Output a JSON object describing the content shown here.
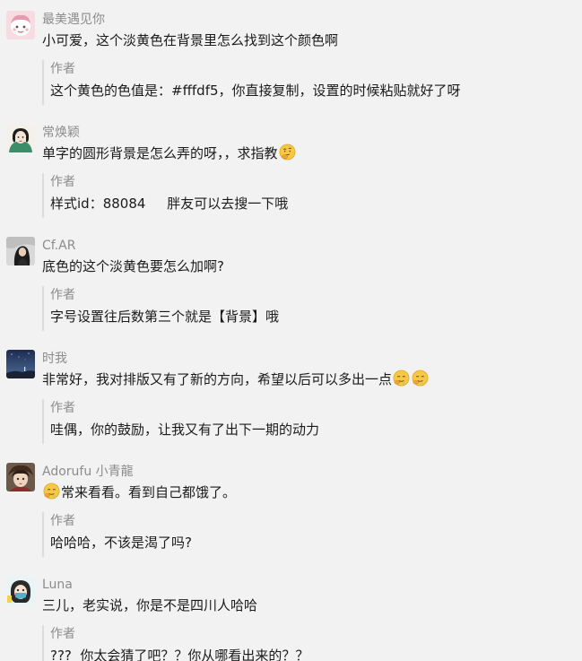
{
  "comments": [
    {
      "nickname": "最美遇见你",
      "avatar": "cartoon-girl-avatar",
      "content": "小可爱，这个淡黄色在背景里怎么找到这个颜色啊",
      "reply": {
        "author": "作者",
        "content": "这个黄色的色值是：#fffdf5，你直接复制，设置的时候粘贴就好了呀"
      }
    },
    {
      "nickname": "常焕颖",
      "avatar": "illustrated-portrait-avatar",
      "content": "单字的圆形背景是怎么弄的呀，，求指教",
      "emojis": [
        "thinking-face-emoji"
      ],
      "reply": {
        "author": "作者",
        "content": "样式id：88084     胖友可以去搜一下哦"
      }
    },
    {
      "nickname": "Cf.AR",
      "avatar": "photo-portrait-avatar",
      "content": "底色的这个淡黄色要怎么加啊?",
      "reply": {
        "author": "作者",
        "content": "字号设置往后数第三个就是【背景】哦"
      }
    },
    {
      "nickname": "时我",
      "avatar": "night-sky-avatar",
      "content": "非常好，我对排版又有了新的方向，希望以后可以多出一点",
      "emojis": [
        "drooling-face-emoji",
        "drooling-face-emoji"
      ],
      "reply": {
        "author": "作者",
        "content": "哇偶，你的鼓励，让我又有了出下一期的动力"
      }
    },
    {
      "nickname": "Adorufu 小青龍",
      "avatar": "anime-character-avatar",
      "content": "常来看看。看到自己都饿了。",
      "emojis": [
        "drooling-face-emoji"
      ],
      "reply": {
        "author": "作者",
        "content": "哈哈哈，不该是渴了吗?"
      }
    },
    {
      "nickname": "Luna",
      "avatar": "cartoon-masked-avatar",
      "content": "三儿，老实说，你是不是四川人哈哈",
      "reply": {
        "author": "作者",
        "content": "???  你太会猜了吧？？你从哪看出来的？？"
      }
    }
  ]
}
